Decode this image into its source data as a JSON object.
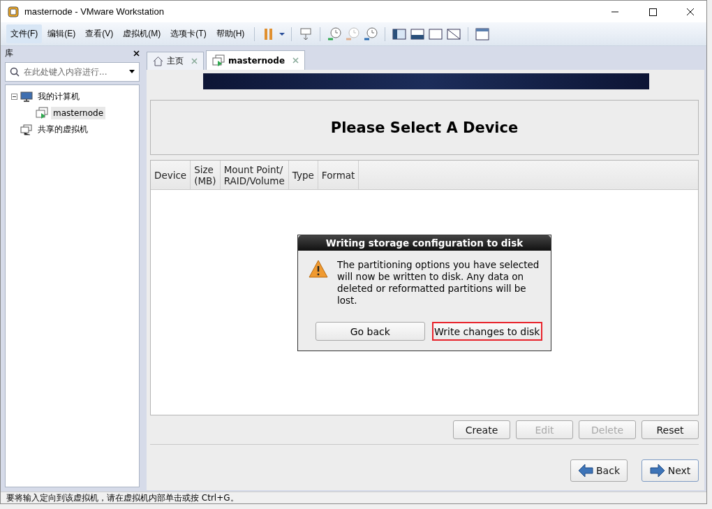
{
  "window": {
    "title": "masternode - VMware Workstation"
  },
  "menu": [
    {
      "label": "文件(F)",
      "selected": true
    },
    {
      "label": "编辑(E)",
      "selected": false
    },
    {
      "label": "查看(V)",
      "selected": false
    },
    {
      "label": "虚拟机(M)",
      "selected": false
    },
    {
      "label": "选项卡(T)",
      "selected": false
    },
    {
      "label": "帮助(H)",
      "selected": false
    }
  ],
  "library": {
    "title": "库",
    "search": {
      "placeholder": "在此处键入内容进行..."
    },
    "tree": [
      {
        "label": "我的计算机",
        "expanded": true,
        "children": [
          {
            "label": "masternode",
            "selected": true
          }
        ]
      },
      {
        "label": "共享的虚拟机"
      }
    ]
  },
  "tabs": [
    {
      "label": "主页",
      "kind": "home",
      "selected": false
    },
    {
      "label": "masternode",
      "kind": "vm",
      "selected": true
    }
  ],
  "installer": {
    "heading": "Please Select A Device",
    "columns": [
      [
        "Device"
      ],
      [
        "Size",
        "(MB)"
      ],
      [
        "Mount Point/",
        "RAID/Volume"
      ],
      [
        "Type"
      ],
      [
        "Format"
      ]
    ],
    "actions": [
      {
        "label": "Create",
        "disabled": false
      },
      {
        "label": "Edit",
        "disabled": true
      },
      {
        "label": "Delete",
        "disabled": true
      },
      {
        "label": "Reset",
        "disabled": false
      }
    ],
    "nav": [
      {
        "label": "Back",
        "kind": "back",
        "focused": false
      },
      {
        "label": "Next",
        "kind": "next",
        "focused": true
      }
    ]
  },
  "dialog": {
    "title": "Writing storage configuration to disk",
    "message": "The partitioning options you have selected will now be written to disk.  Any data on deleted or reformatted partitions will be lost.",
    "buttons": [
      {
        "label": "Go back",
        "highlighted": false
      },
      {
        "label": "Write changes to disk",
        "highlighted": true
      }
    ]
  },
  "status_bar": "要将输入定向到该虚拟机，请在虚拟机内部单击或按 Ctrl+G。"
}
